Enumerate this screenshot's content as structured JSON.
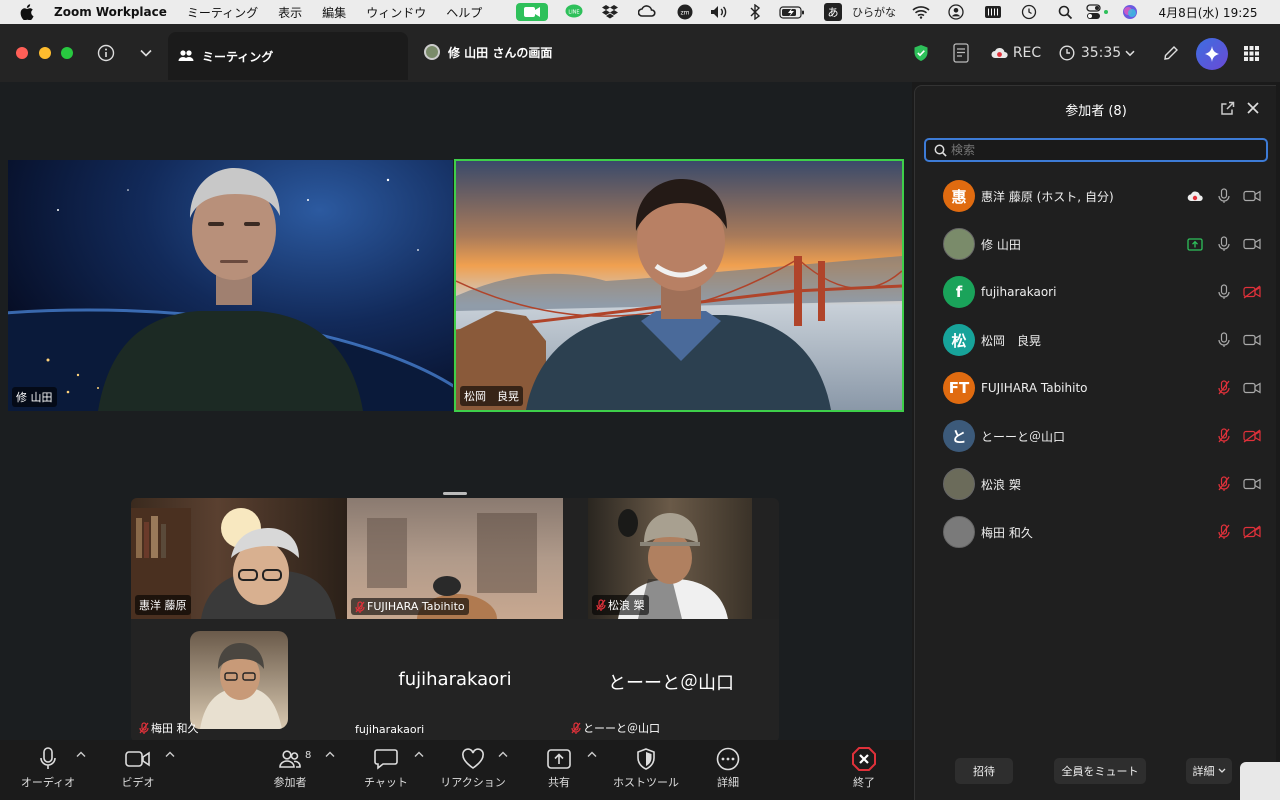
{
  "menubar": {
    "app_name": "Zoom Workplace",
    "items": [
      "ミーティング",
      "表示",
      "編集",
      "ウィンドウ",
      "ヘルプ"
    ],
    "ime": "あ",
    "ime_label": "ひらがな",
    "clock": "4月8日(水)  19:25"
  },
  "titlebar": {
    "tab_meeting": "ミーティング",
    "tab_screen": "修 山田 さんの画面",
    "rec_label": "REC",
    "timer": "35:35"
  },
  "video": {
    "tile1_name": "修 山田",
    "tile2_name": "松岡　良晃"
  },
  "gallery": {
    "tiles": [
      {
        "name": "惠洋 藤原",
        "muted": false
      },
      {
        "name": "FUJIHARA Tabihito",
        "muted": true
      },
      {
        "name": "松浪 槊",
        "muted": true
      },
      {
        "name": "梅田 和久",
        "muted": true
      },
      {
        "name": "fujiharakaori",
        "center_text": "fujiharakaori",
        "muted": false
      },
      {
        "name": "とーーと＠山口",
        "center_text": "とーーと＠山口",
        "muted": true
      }
    ]
  },
  "toolbar": {
    "audio": "オーディオ",
    "video": "ビデオ",
    "participants": "参加者",
    "participants_count": "8",
    "chat": "チャット",
    "reaction": "リアクション",
    "share": "共有",
    "host_tools": "ホストツール",
    "more": "詳細",
    "end": "終了"
  },
  "panel": {
    "title": "参加者 (8)",
    "search_placeholder": "検索",
    "participants": [
      {
        "name": "惠洋 藤原 (ホスト, 自分)",
        "avatar_text": "惠",
        "avatar_color": "#e06b10",
        "mic": "on",
        "cam": "on",
        "extra": "cloud-rec"
      },
      {
        "name": "修 山田",
        "avatar_text": "",
        "avatar_color": "#7a8b6a",
        "mic": "on",
        "cam": "on",
        "extra": "share-screen"
      },
      {
        "name": "fujiharakaori",
        "avatar_text": "f",
        "avatar_color": "#1aa35a",
        "mic": "on",
        "cam": "off",
        "extra": ""
      },
      {
        "name": "松岡　良晃",
        "avatar_text": "松",
        "avatar_color": "#17a39a",
        "mic": "on",
        "cam": "on",
        "extra": ""
      },
      {
        "name": "FUJIHARA Tabihito",
        "avatar_text": "FT",
        "avatar_color": "#e06b10",
        "mic": "off",
        "cam": "on",
        "extra": ""
      },
      {
        "name": "とーーと＠山口",
        "avatar_text": "と",
        "avatar_color": "#3c5a7a",
        "mic": "off",
        "cam": "off",
        "extra": ""
      },
      {
        "name": "松浪 槊",
        "avatar_text": "",
        "avatar_color": "#6b6b5a",
        "mic": "off",
        "cam": "on",
        "extra": ""
      },
      {
        "name": "梅田 和久",
        "avatar_text": "",
        "avatar_color": "#7a7a7a",
        "mic": "off",
        "cam": "off",
        "extra": ""
      }
    ],
    "invite": "招待",
    "mute_all": "全員をミュート",
    "more": "詳細"
  },
  "colors": {
    "accent_blue": "#3d7bd6",
    "active_speaker": "#3ecf4a",
    "muted_red": "#e0313a",
    "end_red": "#e0313a"
  }
}
